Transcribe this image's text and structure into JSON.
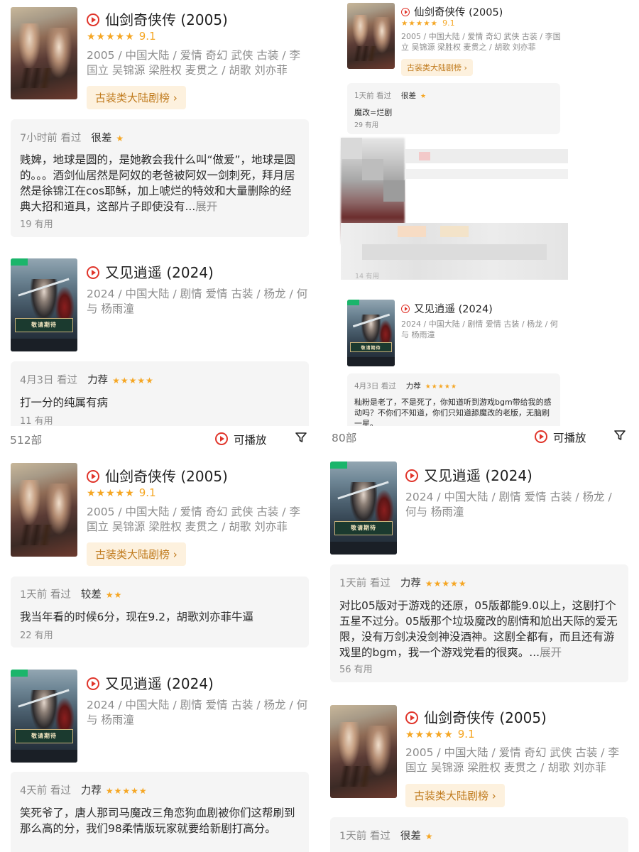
{
  "shows": {
    "xianjian": {
      "title": "仙剑奇侠传 (2005)",
      "stars": "★★★★★",
      "score": "9.1",
      "meta": "2005 / 中国大陆 / 爱情 奇幻 武侠 古装 / 李国立 吴锦源 梁胜权 麦贯之 / 胡歌 刘亦菲",
      "rank_button": "古装类大陆剧榜 ›"
    },
    "youjian": {
      "title": "又见逍遥 (2024)",
      "meta": "2024 / 中国大陆 / 剧情 爱情 古装 / 杨龙 / 何与 杨雨潼",
      "banner": "敬请期待"
    }
  },
  "top_left": {
    "review1": {
      "time": "7小时前 看过",
      "level": "很差",
      "stars": "★",
      "text": "贱婢，地球是圆的，是她教会我什么叫“做爱”，地球是圆的。。。酒剑仙居然是阿奴的老爸被阿奴一剑刺死，拜月居然是徐锦江在cos耶稣，加上唬烂的特效和大量删除的经典大招和道具，这部片子即使没有...",
      "expand": "展开",
      "useful": "19 有用"
    },
    "review2": {
      "time": "4月3日 看过",
      "level": "力荐",
      "stars": "★★★★★",
      "text": "打一分的纯属有病",
      "useful": "11 有用"
    }
  },
  "top_right": {
    "review1": {
      "time": "1天前 看过",
      "level": "很差",
      "stars": "★",
      "text": "魔改=烂剧",
      "useful": "29 有用"
    },
    "blurred_useful": "14 有用",
    "review2": {
      "time": "4月3日 看过",
      "level": "力荐",
      "stars": "★★★★★",
      "text": "籼粉是老了，不是死了，你知道听到游戏bgm带给我的感动吗？不你们不知道，你们只知道舔魔改的老版，无脑刷一星。"
    }
  },
  "filter_left": {
    "count": "512部",
    "playable": "可播放"
  },
  "filter_right": {
    "count": "80部",
    "playable": "可播放"
  },
  "bottom_left": {
    "review1": {
      "time": "1天前 看过",
      "level": "较差",
      "stars": "★★",
      "text": "我当年看的时候6分，现在9.2，胡歌刘亦菲牛逼",
      "useful": "22 有用"
    },
    "review2": {
      "time": "4天前 看过",
      "level": "力荐",
      "stars": "★★★★★",
      "text": "笑死爷了，唐人那司马魔改三角恋狗血剧被你们这帮刷到那么高的分，我们98柔情版玩家就要给新剧打高分。"
    }
  },
  "bottom_right": {
    "review1": {
      "time": "1天前 看过",
      "level": "力荐",
      "stars": "★★★★★",
      "text": "对比05版对于游戏的还原，05版都能9.0以上，这剧打个五星不过分。05版那个垃圾魔改的剧情和尬出天际的爱无限，没有万剑决没剑神没酒神。这剧全都有，而且还有游戏里的bgm，我一个游戏党看的很爽。...",
      "expand": "展开",
      "useful": "56 有用"
    },
    "review2": {
      "time": "1天前 看过",
      "level": "很差",
      "stars": "★"
    }
  },
  "colors": {
    "accent_red": "#e0352b",
    "star_orange": "#f5a623",
    "rank_bg": "#fdf1de",
    "rank_text": "#c07b1e"
  }
}
